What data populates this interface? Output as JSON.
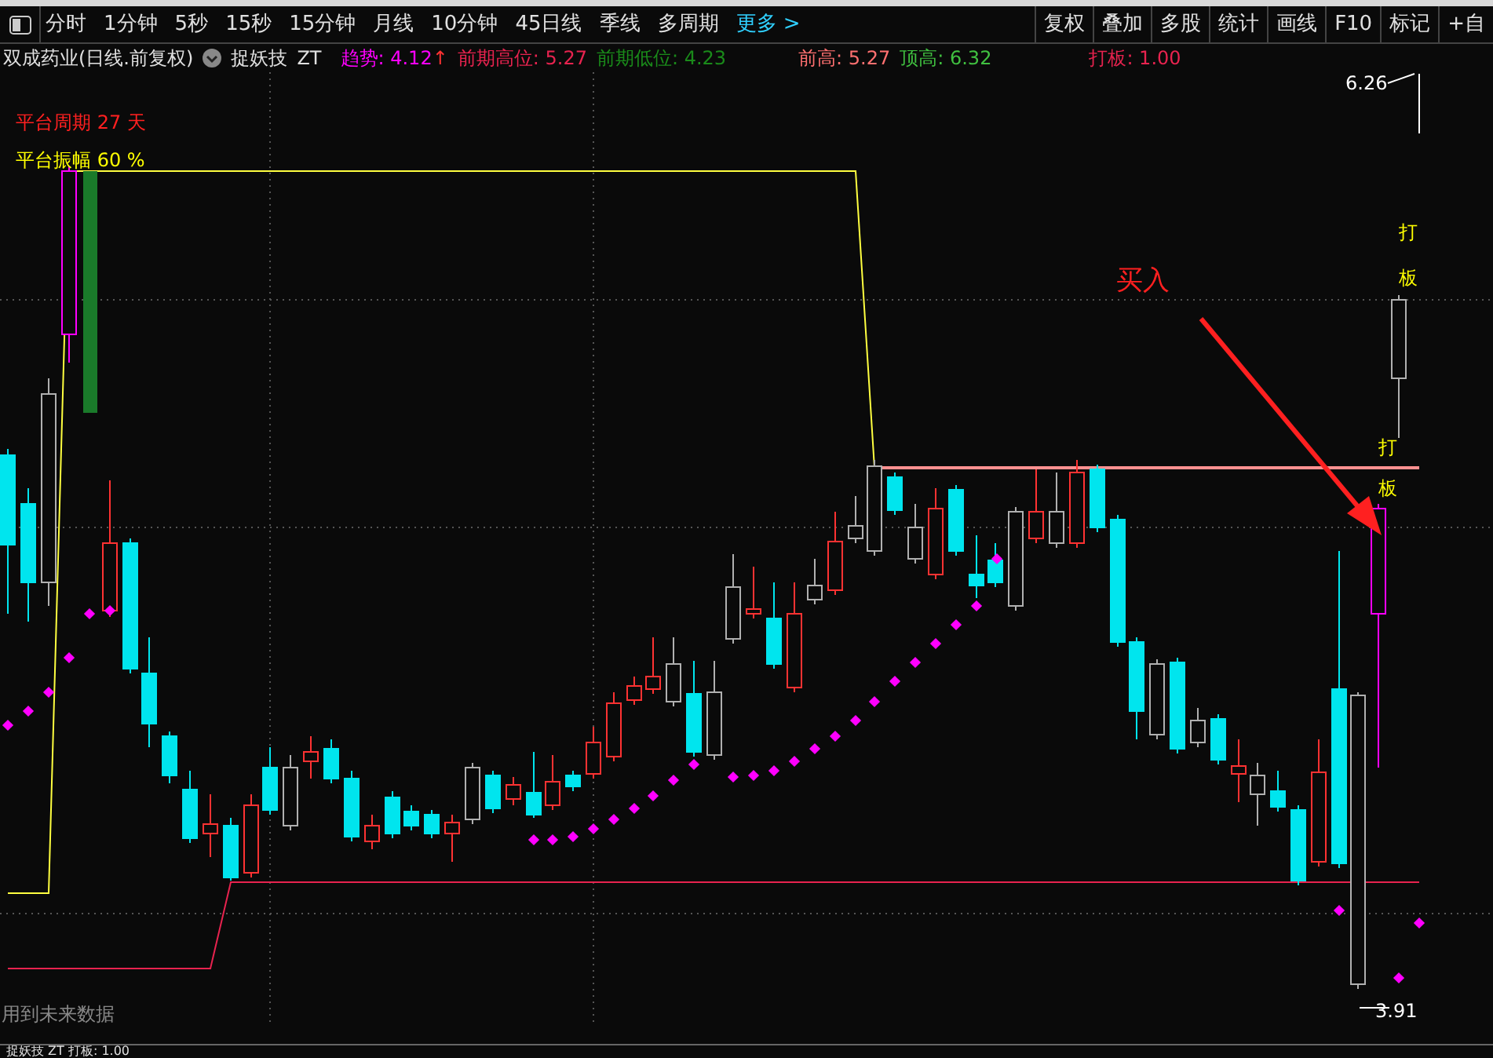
{
  "toolbar": {
    "periods": [
      "分时",
      "1分钟",
      "5秒",
      "15秒",
      "15分钟",
      "月线",
      "10分钟",
      "45日线",
      "季线",
      "多周期"
    ],
    "more": "更多",
    "more_chevron": ">",
    "buttons": [
      "复权",
      "叠加",
      "多股",
      "统计",
      "画线",
      "F10",
      "标记",
      "+自"
    ]
  },
  "info_line": {
    "stock": "双成药业(日线.前复权)",
    "indicator": "捉妖技",
    "code": "ZT",
    "values": [
      {
        "text": "趋势: 4.12",
        "arrow": "↑",
        "color": "#ff00ff"
      },
      {
        "text": "前期高位: 5.27",
        "color": "#e8234f"
      },
      {
        "text": "前期低位: 4.23",
        "color": "#1a8a1a"
      },
      {
        "text": "前高: 5.27",
        "color": "#ff7070"
      },
      {
        "text": "顶高: 6.32",
        "color": "#40c040"
      },
      {
        "text": "打板: 1.00",
        "color": "#e8234f"
      }
    ]
  },
  "chart": {
    "labels": [
      {
        "text": "平台周期 27 天",
        "color": "#ff2020"
      },
      {
        "text": "平台振幅 60 %",
        "color": "#ffff00"
      }
    ],
    "buy_label": "买入",
    "signal_marks": [
      "打",
      "板",
      "打",
      "板"
    ],
    "high_price": "6.26",
    "low_price": "3.91",
    "footnote": "用到未来数据"
  },
  "bottom_strip": "捉妖技 ZT 打板: 1.00"
}
